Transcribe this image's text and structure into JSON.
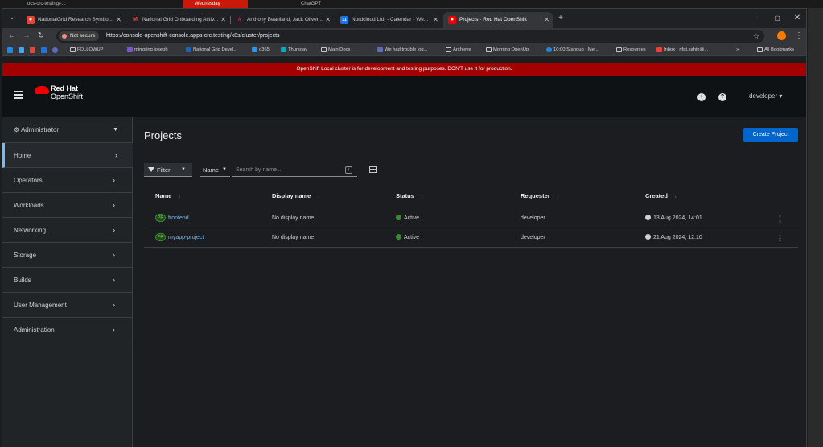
{
  "bg_tabs": [
    "ocs-crc-testing/-...",
    "Wednesday",
    "ChatGPT"
  ],
  "browser": {
    "tabs": [
      {
        "label": "NationalGrid Research Symbol...",
        "fav_color": "#ea4335",
        "fav_glyph": "●"
      },
      {
        "label": "National Grid Onboarding Activ...",
        "fav_color": "#ffffff",
        "fav_glyph": "M"
      },
      {
        "label": "Anthony Beanland, Jack Oliver...",
        "fav_color": "#e01e5a",
        "fav_glyph": "#"
      },
      {
        "label": "Nordcloud Ltd. - Calendar - We...",
        "fav_color": "#1a73e8",
        "fav_glyph": "31"
      },
      {
        "label": "Projects · Red Hat OpenShift",
        "fav_color": "#ee0000",
        "fav_glyph": "●",
        "active": true
      }
    ],
    "new_tab": "+",
    "window_controls": {
      "minimize": "–",
      "restore": "▢",
      "close": "✕"
    },
    "not_secure": "Not secure",
    "url": "https://console-openshift-console.apps-crc.testing/k8s/cluster/projects",
    "bookmarks": [
      {
        "label": "FOLLOWUP",
        "type": "folder"
      },
      {
        "label": "mirroring joseph",
        "type": "link",
        "color": "#7e57c2"
      },
      {
        "label": "National Grid Devel...",
        "type": "link",
        "color": "#1565c0"
      },
      {
        "label": "o365",
        "type": "link",
        "color": "#2196f3"
      },
      {
        "label": "Thursday",
        "type": "link",
        "color": "#00acc1"
      },
      {
        "label": "Main Docs",
        "type": "folder"
      },
      {
        "label": "We had trouble log...",
        "type": "link",
        "color": "#5c6bc0"
      },
      {
        "label": "Archieve",
        "type": "folder"
      },
      {
        "label": "Morning OpenUp",
        "type": "folder"
      },
      {
        "label": "10:00 Standup - Me...",
        "type": "link",
        "color": "#1e88e5"
      },
      {
        "label": "Resources",
        "type": "folder"
      },
      {
        "label": "Inbox - rifat.sahin@...",
        "type": "link",
        "color": "#ea4335"
      }
    ],
    "bookmarks_more": "»",
    "all_bookmarks": "All Bookmarks"
  },
  "console": {
    "banner": "OpenShift Local cluster is for development and testing purposes. DON'T use it for production.",
    "brand_line1": "Red Hat",
    "brand_line2": "OpenShift",
    "user": "developer ▾",
    "perspective": "Administrator",
    "nav": [
      {
        "label": "Home",
        "active": true
      },
      {
        "label": "Operators"
      },
      {
        "label": "Workloads"
      },
      {
        "label": "Networking"
      },
      {
        "label": "Storage"
      },
      {
        "label": "Builds"
      },
      {
        "label": "User Management"
      },
      {
        "label": "Administration"
      }
    ],
    "page_title": "Projects",
    "create_button": "Create Project",
    "filter_label": "Filter",
    "name_dropdown": "Name",
    "search_placeholder": "Search by name...",
    "search_hint": "/",
    "columns": [
      "Name",
      "Display name",
      "Status",
      "Requester",
      "Created"
    ],
    "rows": [
      {
        "badge": "PR",
        "name": "frontend",
        "display_name": "No display name",
        "status": "Active",
        "requester": "developer",
        "created": "13 Aug 2024, 14:01"
      },
      {
        "badge": "PR",
        "name": "myapp-project",
        "display_name": "No display name",
        "status": "Active",
        "requester": "developer",
        "created": "21 Aug 2024, 12:10"
      }
    ]
  },
  "colors": {
    "banner": "#a30000",
    "primary_button": "#0066cc",
    "link": "#73bcf7",
    "active_status": "#3e8635"
  }
}
